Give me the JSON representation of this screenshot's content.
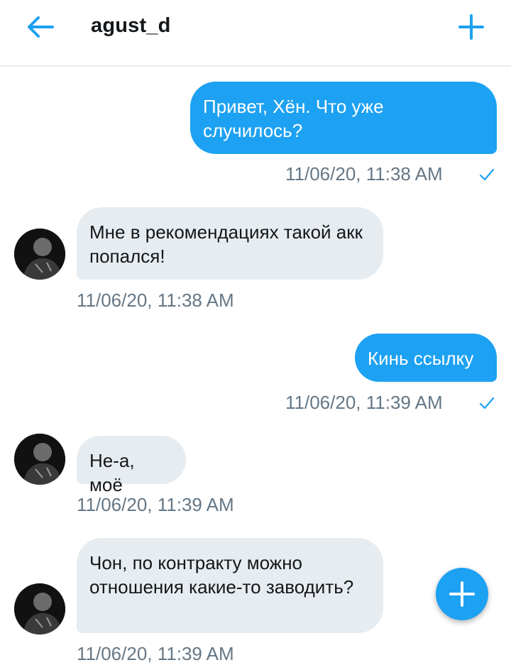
{
  "header": {
    "title": "agust_d",
    "back_icon": "arrow-left-icon",
    "action_icon": "plus-icon",
    "accent": "#1da1f2"
  },
  "messages": [
    {
      "direction": "outgoing",
      "text": "Привет, Хён. Что уже случилось?",
      "time": "11/06/20, 11:38 AM",
      "status_icon": "check-icon"
    },
    {
      "direction": "incoming",
      "text": "Мне в рекомендациях такой акк попался!",
      "time": "11/06/20, 11:38 AM"
    },
    {
      "direction": "outgoing",
      "text": "Кинь ссылку",
      "time": "11/06/20, 11:39 AM",
      "status_icon": "check-icon"
    },
    {
      "direction": "incoming",
      "text": "Не-а, моё",
      "time": "11/06/20, 11:39 AM"
    },
    {
      "direction": "incoming",
      "text": "Чон, по контракту можно отношения какие-то заводить?",
      "time": "11/06/20, 11:39 AM"
    }
  ],
  "fab": {
    "icon": "plus-icon"
  },
  "colors": {
    "outgoing_bubble": "#1da1f2",
    "incoming_bubble": "#e6ecf0",
    "timestamp": "#657786"
  }
}
